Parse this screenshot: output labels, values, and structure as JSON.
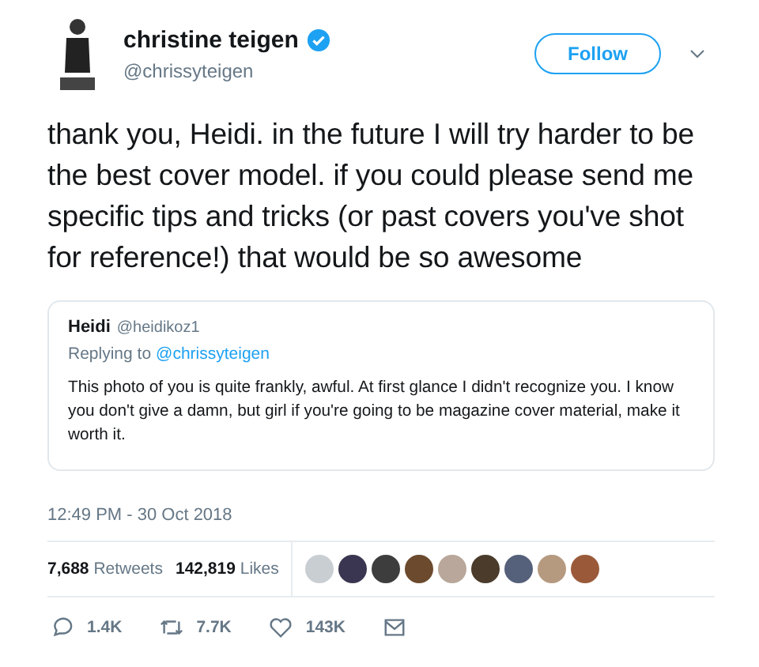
{
  "author": {
    "name": "christine teigen",
    "verified": true,
    "handle": "@chrissyteigen"
  },
  "follow_button": "Follow",
  "tweet_text": "thank you, Heidi. in the future I will try harder to be the best cover model. if you could please send me specific tips and tricks (or past covers you've shot for reference!) that would be so awesome",
  "quoted_tweet": {
    "name": "Heidi",
    "handle": "@heidikoz1",
    "replying_prefix": "Replying to",
    "replying_to": "@chrissyteigen",
    "text": "This photo of you is quite frankly, awful. At first glance I didn't recognize you. I know you don't give a damn, but girl if you're going to be magazine cover material, make it worth it."
  },
  "timestamp": "12:49 PM - 30 Oct 2018",
  "stats": [
    {
      "count": "7,688",
      "label": "Retweets"
    },
    {
      "count": "142,819",
      "label": "Likes"
    }
  ],
  "likers": [
    {
      "color": "#c9ced3"
    },
    {
      "color": "#3a3550"
    },
    {
      "color": "#3d3d3d"
    },
    {
      "color": "#6b4a2e"
    },
    {
      "color": "#b8a79a"
    },
    {
      "color": "#4a3b2a"
    },
    {
      "color": "#55607a"
    },
    {
      "color": "#b59a80"
    },
    {
      "color": "#9a5a3a"
    }
  ],
  "actions": [
    {
      "kind": "reply",
      "count": "1.4K"
    },
    {
      "kind": "retweet",
      "count": "7.7K"
    },
    {
      "kind": "like",
      "count": "143K"
    },
    {
      "kind": "message"
    }
  ]
}
